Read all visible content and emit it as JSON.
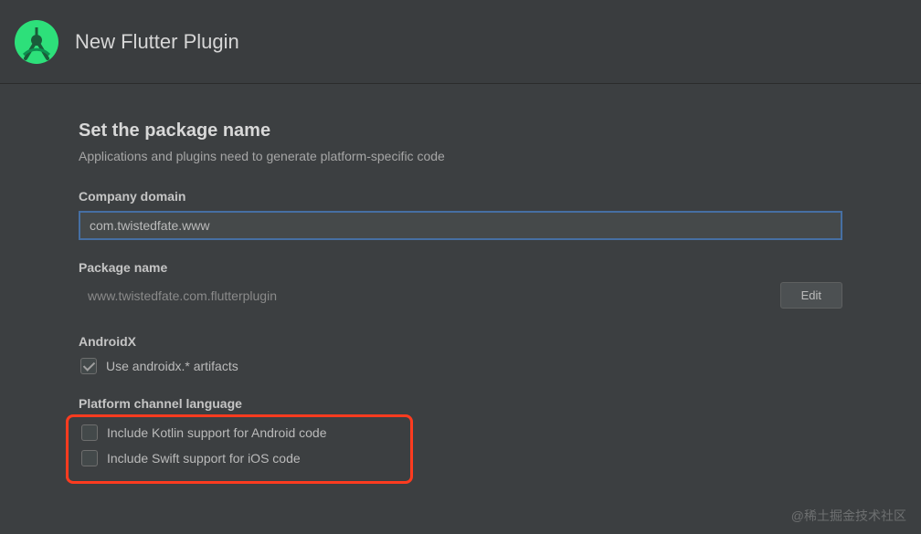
{
  "header": {
    "title": "New Flutter Plugin"
  },
  "section": {
    "title": "Set the package name",
    "subtitle": "Applications and plugins need to generate platform-specific code"
  },
  "company_domain": {
    "label": "Company domain",
    "value": "com.twistedfate.www"
  },
  "package_name": {
    "label": "Package name",
    "value": "www.twistedfate.com.flutterplugin",
    "edit_label": "Edit"
  },
  "androidx": {
    "group_label": "AndroidX",
    "checkbox_label": "Use androidx.* artifacts"
  },
  "platform_channel": {
    "group_label": "Platform channel language",
    "kotlin_label": "Include Kotlin support for Android code",
    "swift_label": "Include Swift support for iOS code"
  },
  "watermark": "@稀土掘金技术社区"
}
